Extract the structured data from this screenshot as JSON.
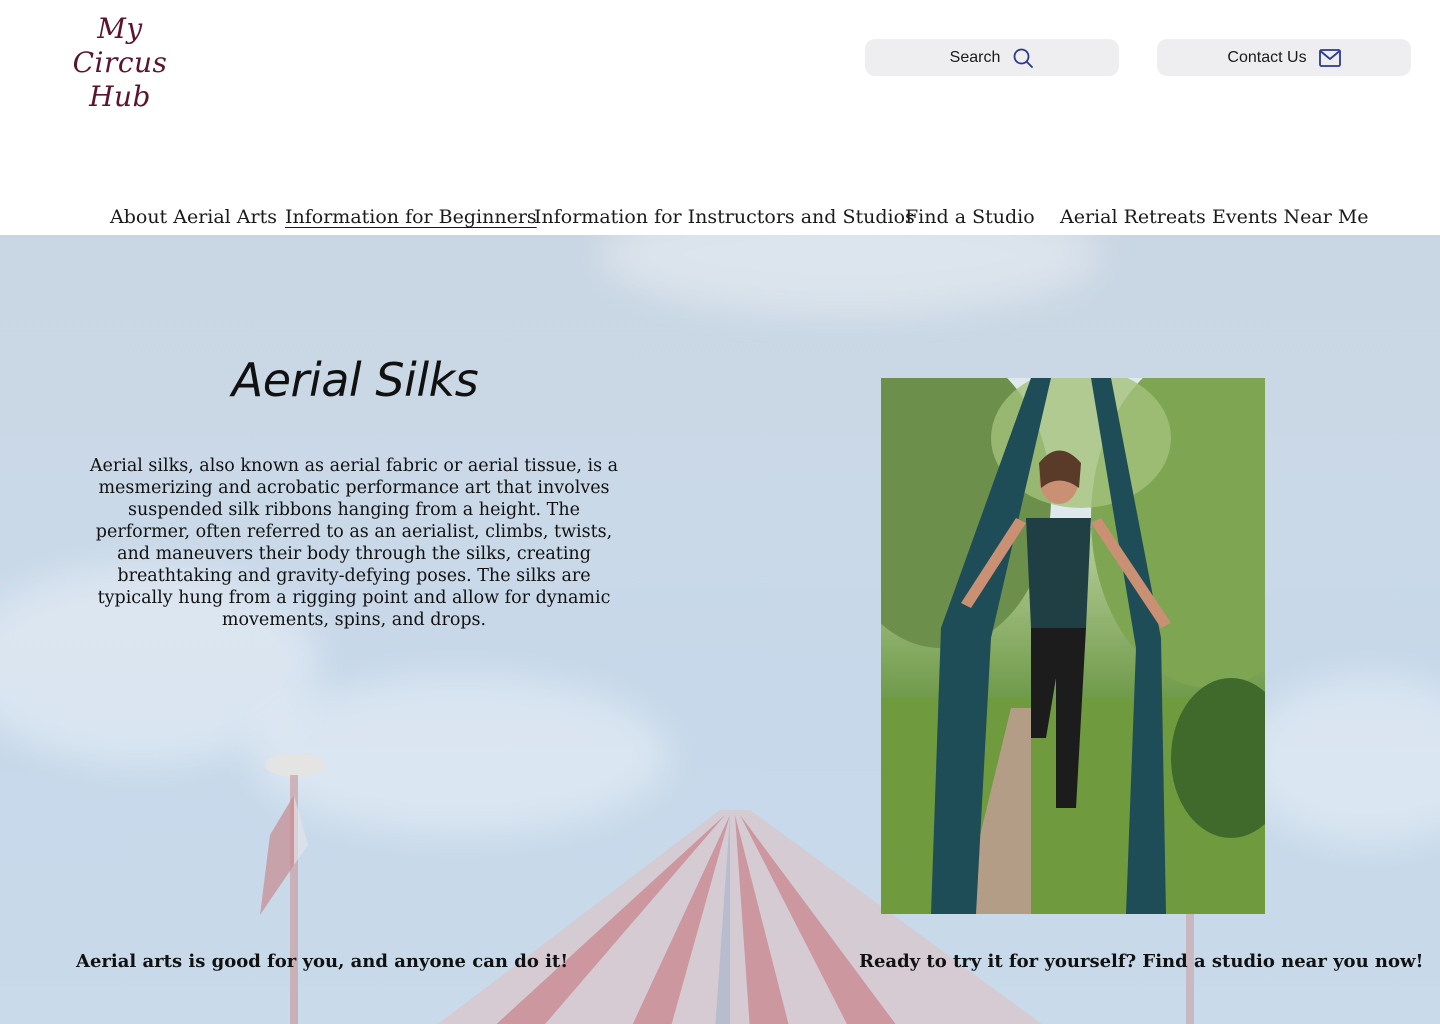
{
  "header": {
    "logo_line1": "My Circus",
    "logo_line2": "Hub",
    "search_label": "Search",
    "contact_label": "Contact Us"
  },
  "nav": {
    "items": [
      {
        "label": "About Aerial Arts"
      },
      {
        "label": "Information for Beginners",
        "active": true
      },
      {
        "label": "Information for Instructors and Studios"
      },
      {
        "label": "Find a Studio"
      },
      {
        "label": "Aerial Retreats"
      },
      {
        "label": "Events Near Me"
      }
    ]
  },
  "main": {
    "title": "Aerial Silks",
    "description": "Aerial silks, also known as aerial fabric or aerial tissue, is a mesmerizing and acrobatic performance art that involves suspended silk ribbons hanging from a height. The performer, often referred to as an aerialist, climbs, twists, and maneuvers their body through the silks, creating breathtaking and gravity-defying poses. The silks are typically hung from a rigging point and allow for dynamic movements, spins, and drops.",
    "tagline_left": "Aerial arts is good for you, and anyone can do it!",
    "tagline_right": "Ready to try it for yourself? Find a studio near you now!"
  },
  "colors": {
    "logo": "#5a1430",
    "pill_bg": "#eeeef0",
    "hero_bg": "#c9d8e8",
    "icon_accent": "#2b3a8c"
  }
}
